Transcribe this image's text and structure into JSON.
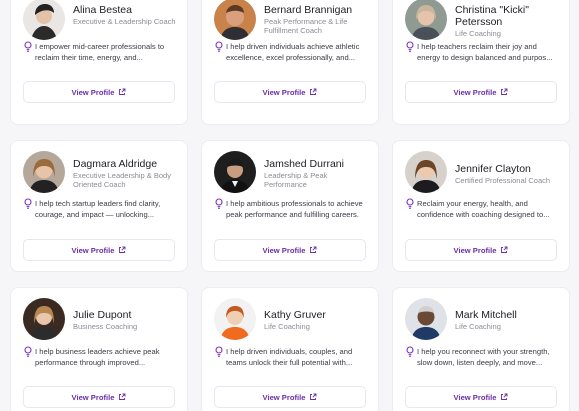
{
  "colors": {
    "accent": "#6b2ea8",
    "bulb": "#7a33b8",
    "page_bg": "#f6f6f8"
  },
  "cards": [
    {
      "name": "Alina Bestea",
      "role": "Executive & Leadership Coach",
      "description": "I empower mid-career professionals to reclaim their time, energy, and...",
      "button": "View Profile",
      "avatar_icon": "person-portrait-icon"
    },
    {
      "name": "Bernard Brannigan",
      "role": "Peak Performance & Life Fulfillment Coach",
      "description": "I help driven individuals achieve athletic excellence, excel professionally, and...",
      "button": "View Profile",
      "avatar_icon": "person-portrait-icon"
    },
    {
      "name": "Christina \"Kicki\" Petersson",
      "role": "Life Coaching",
      "description": "I help teachers reclaim their joy and energy to design balanced and purpos...",
      "button": "View Profile",
      "avatar_icon": "person-portrait-icon"
    },
    {
      "name": "Dagmara Aldridge",
      "role": "Executive Leadership & Body Oriented Coach",
      "description": "I help tech startup leaders find clarity, courage, and impact — unlocking...",
      "button": "View Profile",
      "avatar_icon": "person-portrait-icon"
    },
    {
      "name": "Jamshed Durrani",
      "role": "Leadership & Peak Performance",
      "description": "I help ambitious professionals to achieve peak performance and fulfilling careers.",
      "button": "View Profile",
      "avatar_icon": "person-portrait-icon"
    },
    {
      "name": "Jennifer Clayton",
      "role": "Certified Professional Coach",
      "description": "Reclaim your energy, health, and confidence with coaching designed to...",
      "button": "View Profile",
      "avatar_icon": "person-portrait-icon"
    },
    {
      "name": "Julie Dupont",
      "role": "Business Coaching",
      "description": "I help business leaders achieve peak performance through improved...",
      "button": "View Profile",
      "avatar_icon": "person-portrait-icon"
    },
    {
      "name": "Kathy Gruver",
      "role": "Life Coaching",
      "description": "I help driven individuals, couples, and teams unlock their full potential with...",
      "button": "View Profile",
      "avatar_icon": "person-portrait-icon"
    },
    {
      "name": "Mark Mitchell",
      "role": "Life Coaching",
      "description": "I help you reconnect with your strength, slow down, listen deeply, and move...",
      "button": "View Profile",
      "avatar_icon": "person-portrait-icon"
    }
  ]
}
